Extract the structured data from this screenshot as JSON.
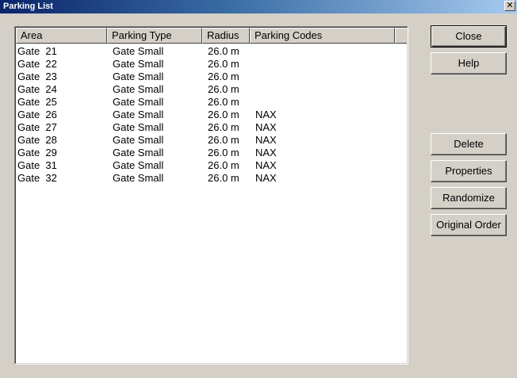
{
  "window": {
    "title": "Parking List",
    "close_glyph": "✕"
  },
  "list": {
    "columns": [
      "Area",
      "Parking Type",
      "Radius",
      "Parking Codes"
    ],
    "rows": [
      [
        "Gate  21",
        "Gate Small",
        "26.0 m",
        ""
      ],
      [
        "Gate  22",
        "Gate Small",
        "26.0 m",
        ""
      ],
      [
        "Gate  23",
        "Gate Small",
        "26.0 m",
        ""
      ],
      [
        "Gate  24",
        "Gate Small",
        "26.0 m",
        ""
      ],
      [
        "Gate  25",
        "Gate Small",
        "26.0 m",
        ""
      ],
      [
        "Gate  26",
        "Gate Small",
        "26.0 m",
        "NAX"
      ],
      [
        "Gate  27",
        "Gate Small",
        "26.0 m",
        "NAX"
      ],
      [
        "Gate  28",
        "Gate Small",
        "26.0 m",
        "NAX"
      ],
      [
        "Gate  29",
        "Gate Small",
        "26.0 m",
        "NAX"
      ],
      [
        "Gate  31",
        "Gate Small",
        "26.0 m",
        "NAX"
      ],
      [
        "Gate  32",
        "Gate Small",
        "26.0 m",
        "NAX"
      ]
    ]
  },
  "buttons": {
    "close": "Close",
    "help": "Help",
    "delete": "Delete",
    "properties": "Properties",
    "randomize": "Randomize",
    "original_order": "Original Order"
  },
  "colors": {
    "titlebar_start": "#0a246a",
    "titlebar_end": "#a6caf0",
    "face": "#d4d0c8"
  }
}
